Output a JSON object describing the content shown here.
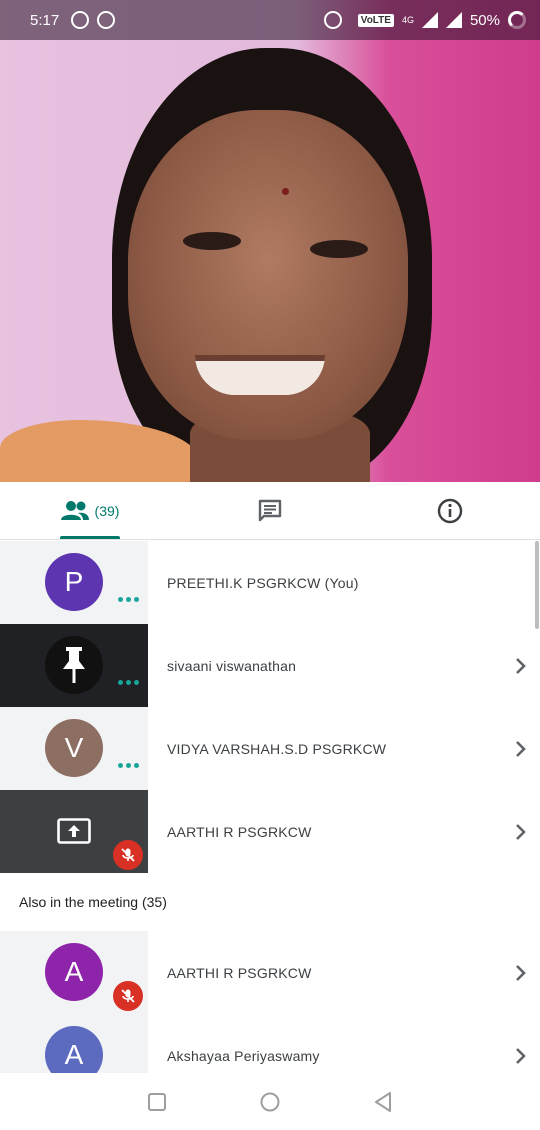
{
  "status_bar": {
    "time": "5:17",
    "network": "VoLTE",
    "network_type": "4G",
    "battery": "50%"
  },
  "tabs": {
    "people_count": "(39)"
  },
  "participants": [
    {
      "name": "PREETHI.K PSGRKCW (You)",
      "initial": "P",
      "avatar_color": "#5e35b1",
      "tile": "light",
      "more": true,
      "muted": false,
      "chevron": false
    },
    {
      "name": "sivaani viswanathan",
      "initial": "",
      "avatar_color": "#111111",
      "tile": "black",
      "more": true,
      "muted": false,
      "chevron": true
    },
    {
      "name": "VIDYA VARSHAH.S.D PSGRKCW",
      "initial": "V",
      "avatar_color": "#8d6e63",
      "tile": "light",
      "more": true,
      "muted": false,
      "chevron": true
    },
    {
      "name": "AARTHI R PSGRKCW",
      "initial": "",
      "avatar_color": "",
      "tile": "dark",
      "more": false,
      "muted": true,
      "chevron": true
    }
  ],
  "also_in_meeting": {
    "label": "Also in the meeting (35)",
    "people": [
      {
        "name": "AARTHI R PSGRKCW",
        "initial": "A",
        "avatar_color": "#8e24aa",
        "muted": true
      },
      {
        "name": "Akshayaa Periyaswamy",
        "initial": "A",
        "avatar_color": "#5c6bc0",
        "muted": false
      }
    ]
  },
  "colors": {
    "accent": "#00796b",
    "muted_red": "#d93025"
  }
}
